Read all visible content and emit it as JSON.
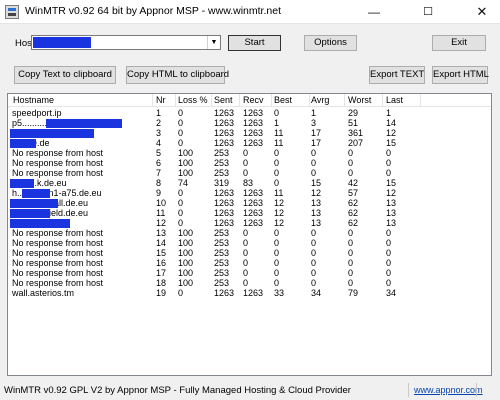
{
  "window": {
    "title": "WinMTR v0.92 64 bit by Appnor MSP - www.winmtr.net",
    "minimize": "—",
    "maximize": "☐",
    "close": "✕"
  },
  "host": {
    "label": "Host:",
    "value": "",
    "start_label": "Start",
    "options_label": "Options",
    "exit_label": "Exit"
  },
  "toolbar": {
    "copy_text_label": "Copy Text to clipboard",
    "copy_html_label": "Copy HTML to clipboard",
    "export_text_label": "Export TEXT",
    "export_html_label": "Export HTML"
  },
  "table": {
    "columns": [
      "Hostname",
      "Nr",
      "Loss %",
      "Sent",
      "Recv",
      "Best",
      "Avrg",
      "Worst",
      "Last"
    ],
    "rows": [
      {
        "host": "speedport.ip",
        "nr": "1",
        "loss": "0",
        "sent": "1263",
        "recv": "1263",
        "best": "0",
        "avrg": "1",
        "worst": "29",
        "last": "1"
      },
      {
        "host": "p5...........net.de",
        "nr": "2",
        "loss": "0",
        "sent": "1263",
        "recv": "1263",
        "best": "1",
        "avrg": "3",
        "worst": "51",
        "last": "14"
      },
      {
        "host": "...........",
        "nr": "3",
        "loss": "0",
        "sent": "1263",
        "recv": "1263",
        "best": "11",
        "avrg": "17",
        "worst": "361",
        "last": "12"
      },
      {
        "host": "f.......e.de",
        "nr": "4",
        "loss": "0",
        "sent": "1263",
        "recv": "1263",
        "best": "11",
        "avrg": "17",
        "worst": "207",
        "last": "15"
      },
      {
        "host": "No response from host",
        "nr": "5",
        "loss": "100",
        "sent": "253",
        "recv": "0",
        "best": "0",
        "avrg": "0",
        "worst": "0",
        "last": "0"
      },
      {
        "host": "No response from host",
        "nr": "6",
        "loss": "100",
        "sent": "253",
        "recv": "0",
        "best": "0",
        "avrg": "0",
        "worst": "0",
        "last": "0"
      },
      {
        "host": "No response from host",
        "nr": "7",
        "loss": "100",
        "sent": "253",
        "recv": "0",
        "best": "0",
        "avrg": "0",
        "worst": "0",
        "last": "0"
      },
      {
        "host": "..........k.de.eu",
        "nr": "8",
        "loss": "74",
        "sent": "319",
        "recv": "83",
        "best": "0",
        "avrg": "15",
        "worst": "42",
        "last": "15"
      },
      {
        "host": "h........wan1-a75.de.eu",
        "nr": "9",
        "loss": "0",
        "sent": "1263",
        "recv": "1263",
        "best": "11",
        "avrg": "12",
        "worst": "57",
        "last": "12"
      },
      {
        "host": "........-firewall.de.eu",
        "nr": "10",
        "loss": "0",
        "sent": "1263",
        "recv": "1263",
        "best": "12",
        "avrg": "13",
        "worst": "62",
        "last": "13"
      },
      {
        "host": "...........shield.de.eu",
        "nr": "11",
        "loss": "0",
        "sent": "1263",
        "recv": "1263",
        "best": "12",
        "avrg": "13",
        "worst": "62",
        "last": "13"
      },
      {
        "host": "...........3.de.eu",
        "nr": "12",
        "loss": "0",
        "sent": "1263",
        "recv": "1263",
        "best": "12",
        "avrg": "13",
        "worst": "62",
        "last": "13"
      },
      {
        "host": "No response from host",
        "nr": "13",
        "loss": "100",
        "sent": "253",
        "recv": "0",
        "best": "0",
        "avrg": "0",
        "worst": "0",
        "last": "0"
      },
      {
        "host": "No response from host",
        "nr": "14",
        "loss": "100",
        "sent": "253",
        "recv": "0",
        "best": "0",
        "avrg": "0",
        "worst": "0",
        "last": "0"
      },
      {
        "host": "No response from host",
        "nr": "15",
        "loss": "100",
        "sent": "253",
        "recv": "0",
        "best": "0",
        "avrg": "0",
        "worst": "0",
        "last": "0"
      },
      {
        "host": "No response from host",
        "nr": "16",
        "loss": "100",
        "sent": "253",
        "recv": "0",
        "best": "0",
        "avrg": "0",
        "worst": "0",
        "last": "0"
      },
      {
        "host": "No response from host",
        "nr": "17",
        "loss": "100",
        "sent": "253",
        "recv": "0",
        "best": "0",
        "avrg": "0",
        "worst": "0",
        "last": "0"
      },
      {
        "host": "No response from host",
        "nr": "18",
        "loss": "100",
        "sent": "253",
        "recv": "0",
        "best": "0",
        "avrg": "0",
        "worst": "0",
        "last": "0"
      },
      {
        "host": "wall.asterios.tm",
        "nr": "19",
        "loss": "0",
        "sent": "1263",
        "recv": "1263",
        "best": "33",
        "avrg": "34",
        "worst": "79",
        "last": "34"
      }
    ]
  },
  "status": {
    "text": "WinMTR v0.92 GPL V2 by Appnor MSP - Fully Managed Hosting & Cloud Provider",
    "link": "www.appnor.com"
  },
  "colors": {
    "redaction": "#1a35e0",
    "link": "#0645ad"
  }
}
